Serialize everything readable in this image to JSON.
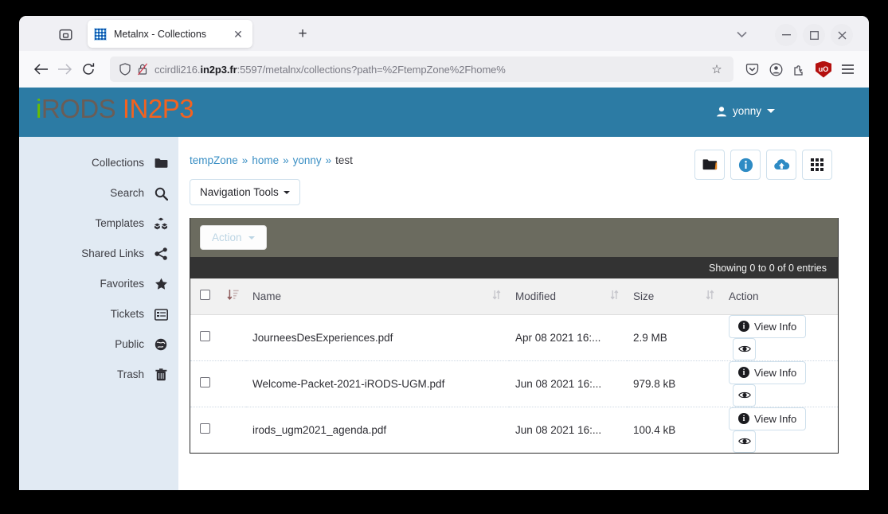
{
  "browser": {
    "tab": {
      "title": "Metalnx - Collections",
      "favicon": "metalnx-favicon",
      "close": "✕"
    },
    "newtab_label": "+",
    "toolbar": {
      "back": "back-arrow",
      "forward": "forward-arrow",
      "reload": "reload-icon",
      "url_prefix": "ccirdli216.",
      "url_domain": "in2p3.fr",
      "url_suffix": ":5597/metalnx/collections?path=%2FtempZone%2Fhome%",
      "bookmark": "☆",
      "items": [
        "pocket-icon",
        "account-icon",
        "extensions-icon",
        "ublock-icon",
        "menu-icon"
      ],
      "ublock_label": "uO"
    },
    "window_controls": {
      "list_tabs": "chevron-down-icon",
      "minimize": "—",
      "maximize": "□",
      "close": "✕"
    }
  },
  "app": {
    "logo": {
      "i": "i",
      "rods": "RODS",
      "in2p3": "IN2P3"
    },
    "user": {
      "name": "yonny",
      "icon": "user-icon"
    },
    "header_color": "#2c7ba4",
    "sidebar_color": "#e1eaf3"
  },
  "sidebar": {
    "items": [
      {
        "label": "Collections",
        "icon": "folder-icon"
      },
      {
        "label": "Search",
        "icon": "search-icon"
      },
      {
        "label": "Templates",
        "icon": "cubes-icon"
      },
      {
        "label": "Shared Links",
        "icon": "share-icon"
      },
      {
        "label": "Favorites",
        "icon": "star-icon"
      },
      {
        "label": "Tickets",
        "icon": "list-alt-icon"
      },
      {
        "label": "Public",
        "icon": "globe-icon"
      },
      {
        "label": "Trash",
        "icon": "trash-icon"
      }
    ]
  },
  "main": {
    "breadcrumb": [
      {
        "label": "tempZone",
        "current": false
      },
      {
        "label": "home",
        "current": false
      },
      {
        "label": "yonny",
        "current": false
      },
      {
        "label": "test",
        "current": true
      }
    ],
    "breadcrumb_separator": "»",
    "top_actions": [
      {
        "name": "new-collection-button",
        "icon": "folder-icon"
      },
      {
        "name": "collection-info-button",
        "icon": "info-circle-icon"
      },
      {
        "name": "upload-button",
        "icon": "cloud-upload-icon"
      },
      {
        "name": "grid-view-button",
        "icon": "grid-icon"
      }
    ],
    "navigation_tools_label": "Navigation Tools",
    "action_label": "Action",
    "entries_info": "Showing 0 to 0 of 0 entries",
    "table": {
      "columns": [
        "Name",
        "Modified",
        "Size",
        "Action"
      ],
      "sort_icon": "sort-icon",
      "sort_amount_icon": "sort-amount-asc-icon",
      "select_all": "select-all-checkbox",
      "rows": [
        {
          "name": "JourneesDesExperiences.pdf",
          "modified": "Apr 08 2021 16:...",
          "size": "2.9 MB",
          "view_info": "View Info",
          "preview_icon": "eye-icon"
        },
        {
          "name": "Welcome-Packet-2021-iRODS-UGM.pdf",
          "modified": "Jun 08 2021 16:...",
          "size": "979.8 kB",
          "view_info": "View Info",
          "preview_icon": "eye-icon"
        },
        {
          "name": "irods_ugm2021_agenda.pdf",
          "modified": "Jun 08 2021 16:...",
          "size": "100.4 kB",
          "view_info": "View Info",
          "preview_icon": "eye-icon"
        }
      ]
    }
  }
}
